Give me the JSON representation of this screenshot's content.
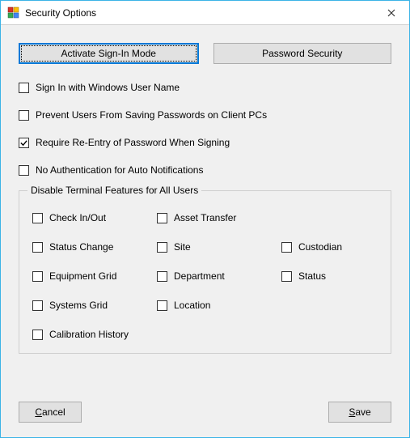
{
  "window": {
    "title": "Security Options"
  },
  "buttons": {
    "activate": "Activate Sign-In Mode",
    "password_security": "Password Security",
    "cancel": "Cancel",
    "save": "Save"
  },
  "options": {
    "signin_windows": {
      "label": "Sign In with Windows User Name",
      "checked": false
    },
    "prevent_save_pw": {
      "label": "Prevent Users From Saving Passwords on Client PCs",
      "checked": false
    },
    "require_reentry": {
      "label": "Require Re-Entry of Password When Signing",
      "checked": true
    },
    "no_auth_auto": {
      "label": "No Authentication for Auto Notifications",
      "checked": false
    }
  },
  "group": {
    "title": "Disable Terminal Features for All Users",
    "items": {
      "check_in_out": {
        "label": "Check In/Out",
        "checked": false
      },
      "asset_transfer": {
        "label": "Asset Transfer",
        "checked": false
      },
      "status_change": {
        "label": "Status Change",
        "checked": false
      },
      "site": {
        "label": "Site",
        "checked": false
      },
      "custodian": {
        "label": "Custodian",
        "checked": false
      },
      "equipment_grid": {
        "label": "Equipment Grid",
        "checked": false
      },
      "department": {
        "label": "Department",
        "checked": false
      },
      "status": {
        "label": "Status",
        "checked": false
      },
      "systems_grid": {
        "label": "Systems Grid",
        "checked": false
      },
      "location": {
        "label": "Location",
        "checked": false
      },
      "calibration_history": {
        "label": "Calibration History",
        "checked": false
      }
    }
  }
}
